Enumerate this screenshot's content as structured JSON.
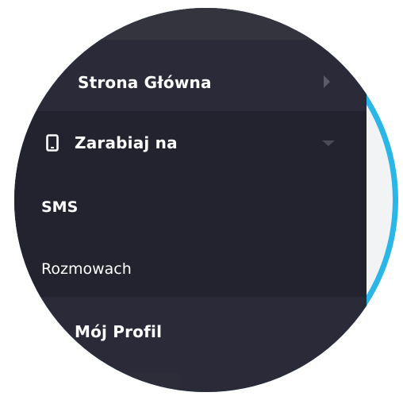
{
  "nav": {
    "home": {
      "label": "Strona Główna",
      "icon": "home-icon"
    },
    "earn": {
      "label": "Zarabiaj na",
      "icon": "mobile-phone-icon",
      "expanded": true,
      "children": [
        {
          "label": "SMS",
          "active": true
        },
        {
          "label": "Rozmowach",
          "active": false
        }
      ]
    },
    "profile": {
      "label": "Mój Profil",
      "icon": "profile-icon"
    }
  },
  "colors": {
    "ring": "#2ab6e6",
    "sidebar_bg": "#2a2a38",
    "submenu_bg": "#232330",
    "content_bg": "#f2f3f5",
    "text": "#ffffff"
  }
}
